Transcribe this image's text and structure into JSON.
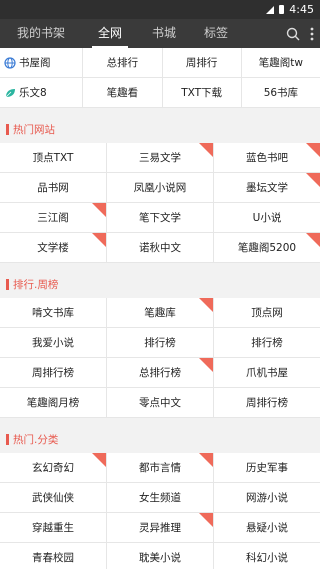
{
  "status": {
    "time": "4:45"
  },
  "tabs": [
    "我的书架",
    "全网",
    "书城",
    "标签"
  ],
  "quick_rows": [
    {
      "items": [
        "书屋阁",
        "总排行",
        "周排行",
        "笔趣阁tw"
      ]
    },
    {
      "items": [
        "乐文8",
        "笔趣看",
        "TXT下载",
        "56书库"
      ]
    }
  ],
  "sections": [
    {
      "title": "热门网站",
      "rows": [
        [
          {
            "label": "顶点TXT",
            "hot": false
          },
          {
            "label": "三易文学",
            "hot": true
          },
          {
            "label": "蓝色书吧",
            "hot": true
          }
        ],
        [
          {
            "label": "品书网",
            "hot": false
          },
          {
            "label": "凤凰小说网",
            "hot": false
          },
          {
            "label": "墨坛文学",
            "hot": true
          }
        ],
        [
          {
            "label": "三江阁",
            "hot": true
          },
          {
            "label": "笔下文学",
            "hot": false
          },
          {
            "label": "U小说",
            "hot": false
          }
        ],
        [
          {
            "label": "文学楼",
            "hot": true
          },
          {
            "label": "诺秋中文",
            "hot": false
          },
          {
            "label": "笔趣阁5200",
            "hot": true
          }
        ]
      ]
    },
    {
      "title": "排行.周榜",
      "rows": [
        [
          {
            "label": "啃文书库",
            "hot": false
          },
          {
            "label": "笔趣库",
            "hot": true
          },
          {
            "label": "顶点网",
            "hot": false
          }
        ],
        [
          {
            "label": "我爱小说",
            "hot": false
          },
          {
            "label": "排行榜",
            "hot": false
          },
          {
            "label": "排行榜",
            "hot": false
          }
        ],
        [
          {
            "label": "周排行榜",
            "hot": false
          },
          {
            "label": "总排行榜",
            "hot": true
          },
          {
            "label": "爪机书屋",
            "hot": false
          }
        ],
        [
          {
            "label": "笔趣阁月榜",
            "hot": false
          },
          {
            "label": "零点中文",
            "hot": false
          },
          {
            "label": "周排行榜",
            "hot": false
          }
        ]
      ]
    },
    {
      "title": "热门.分类",
      "rows": [
        [
          {
            "label": "玄幻奇幻",
            "hot": true
          },
          {
            "label": "都市言情",
            "hot": true
          },
          {
            "label": "历史军事",
            "hot": false
          }
        ],
        [
          {
            "label": "武侠仙侠",
            "hot": false
          },
          {
            "label": "女生频道",
            "hot": false
          },
          {
            "label": "网游小说",
            "hot": false
          }
        ],
        [
          {
            "label": "穿越重生",
            "hot": false
          },
          {
            "label": "灵异推理",
            "hot": true
          },
          {
            "label": "悬疑小说",
            "hot": false
          }
        ],
        [
          {
            "label": "青春校园",
            "hot": false
          },
          {
            "label": "耽美小说",
            "hot": false
          },
          {
            "label": "科幻小说",
            "hot": false
          }
        ]
      ]
    }
  ],
  "colors": {
    "accent": "#e85a4f",
    "header": "#3a3a3a",
    "hot_corner": "#ef6a5a"
  },
  "icons": {
    "search": "search-icon",
    "more": "more-vertical-icon",
    "quick0": "globe-icon",
    "quick1": "leaf-icon"
  }
}
